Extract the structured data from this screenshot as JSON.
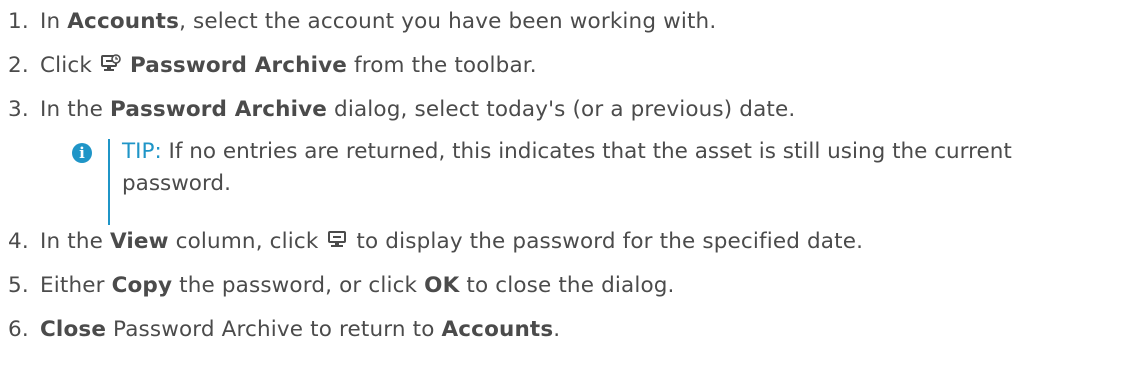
{
  "steps": [
    {
      "num": "1.",
      "pre": "In ",
      "b1": "Accounts",
      "post": ", select the account you have been working with."
    },
    {
      "num": "2.",
      "pre": "Click ",
      "icon": "password-archive-icon",
      "b1": "Password Archive",
      "post": " from the toolbar."
    },
    {
      "num": "3.",
      "pre": "In the ",
      "b1": "Password Archive",
      "post": " dialog, select today's (or a previous) date."
    },
    {
      "num": "4.",
      "pre": "In the ",
      "b1": "View",
      "mid": " column, click ",
      "icon": "view-password-icon",
      "post": " to display the password for the specified date."
    },
    {
      "num": "5.",
      "pre": "Either ",
      "b1": "Copy",
      "mid": " the password, or click ",
      "b2": "OK",
      "post": " to close the dialog."
    },
    {
      "num": "6.",
      "b1": "Close",
      "mid": " Password Archive to return to ",
      "b2": "Accounts",
      "post": "."
    }
  ],
  "tip": {
    "icon": "info-icon",
    "label": "TIP:",
    "text": " If no entries are returned, this indicates that the asset is still using the current password."
  },
  "colors": {
    "text": "#4b4b4b",
    "accent": "#1f95c7"
  }
}
